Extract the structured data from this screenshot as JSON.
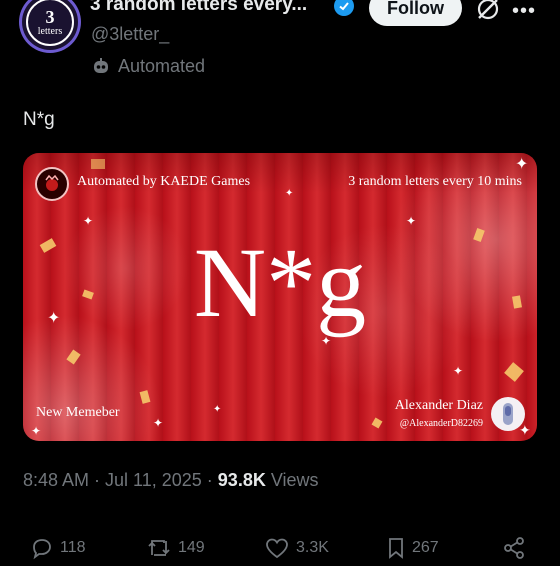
{
  "author": {
    "display_name": "3 random letters every...",
    "handle": "@3letter_",
    "automated_label": "Automated",
    "avatar": {
      "line1": "3",
      "line2": "letters"
    },
    "verified_color": "#1d9bf0"
  },
  "header": {
    "follow_label": "Follow",
    "grok_icon": "grok-icon",
    "more_icon": "more-icon"
  },
  "tweet": {
    "text": "N*g"
  },
  "media": {
    "top_left": "Automated by KAEDE Games",
    "top_right": "3 random letters every 10 mins",
    "letters": "N*g",
    "bottom_left": "New Memeber",
    "author_name": "Alexander Diaz",
    "author_handle": "@AlexanderD82269",
    "background_color": "#c0121b"
  },
  "meta": {
    "time": "8:48 AM",
    "sep1": " · ",
    "date": "Jul 11, 2025",
    "sep2": " · ",
    "views_count": "93.8K",
    "views_label": " Views"
  },
  "actions": {
    "replies": "118",
    "reposts": "149",
    "likes": "3.3K",
    "bookmarks": "267"
  }
}
